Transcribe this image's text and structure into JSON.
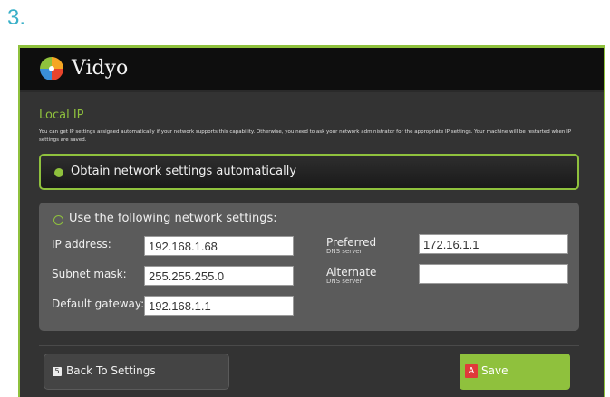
{
  "step": {
    "number": "3."
  },
  "brand": {
    "name": "Vidyo"
  },
  "section": {
    "title": "Local IP",
    "description": "You can get IP settings assigned automatically if your network supports this capability. Otherwise, you need to ask your network administrator for the appropriate IP settings. Your machine will be restarted when IP settings are saved."
  },
  "options": {
    "auto_label": "Obtain network settings automatically",
    "manual_label": "Use the following network settings:",
    "auto_selected": true
  },
  "fields": {
    "ip_address": {
      "label": "IP address:",
      "value": "192.168.1.68"
    },
    "subnet_mask": {
      "label": "Subnet mask:",
      "value": "255.255.255.0"
    },
    "default_gateway": {
      "label": "Default gateway:",
      "value": "192.168.1.1"
    },
    "preferred_dns": {
      "label": "Preferred",
      "sublabel": "DNS server:",
      "value": "172.16.1.1"
    },
    "alternate_dns": {
      "label": "Alternate",
      "sublabel": "DNS server:",
      "value": ""
    }
  },
  "buttons": {
    "back_label": "Back To Settings",
    "save_label": "Save",
    "save_icon_glyph": "A",
    "back_icon_glyph": "5"
  },
  "colors": {
    "accent_green": "#8fc13d",
    "step_blue": "#3ab0c8",
    "save_icon_red": "#e03a3a"
  },
  "icons": {
    "logo": "vidyo-pinwheel-logo",
    "back": "back-arrow-icon",
    "save": "adobe-acrobat-icon"
  }
}
